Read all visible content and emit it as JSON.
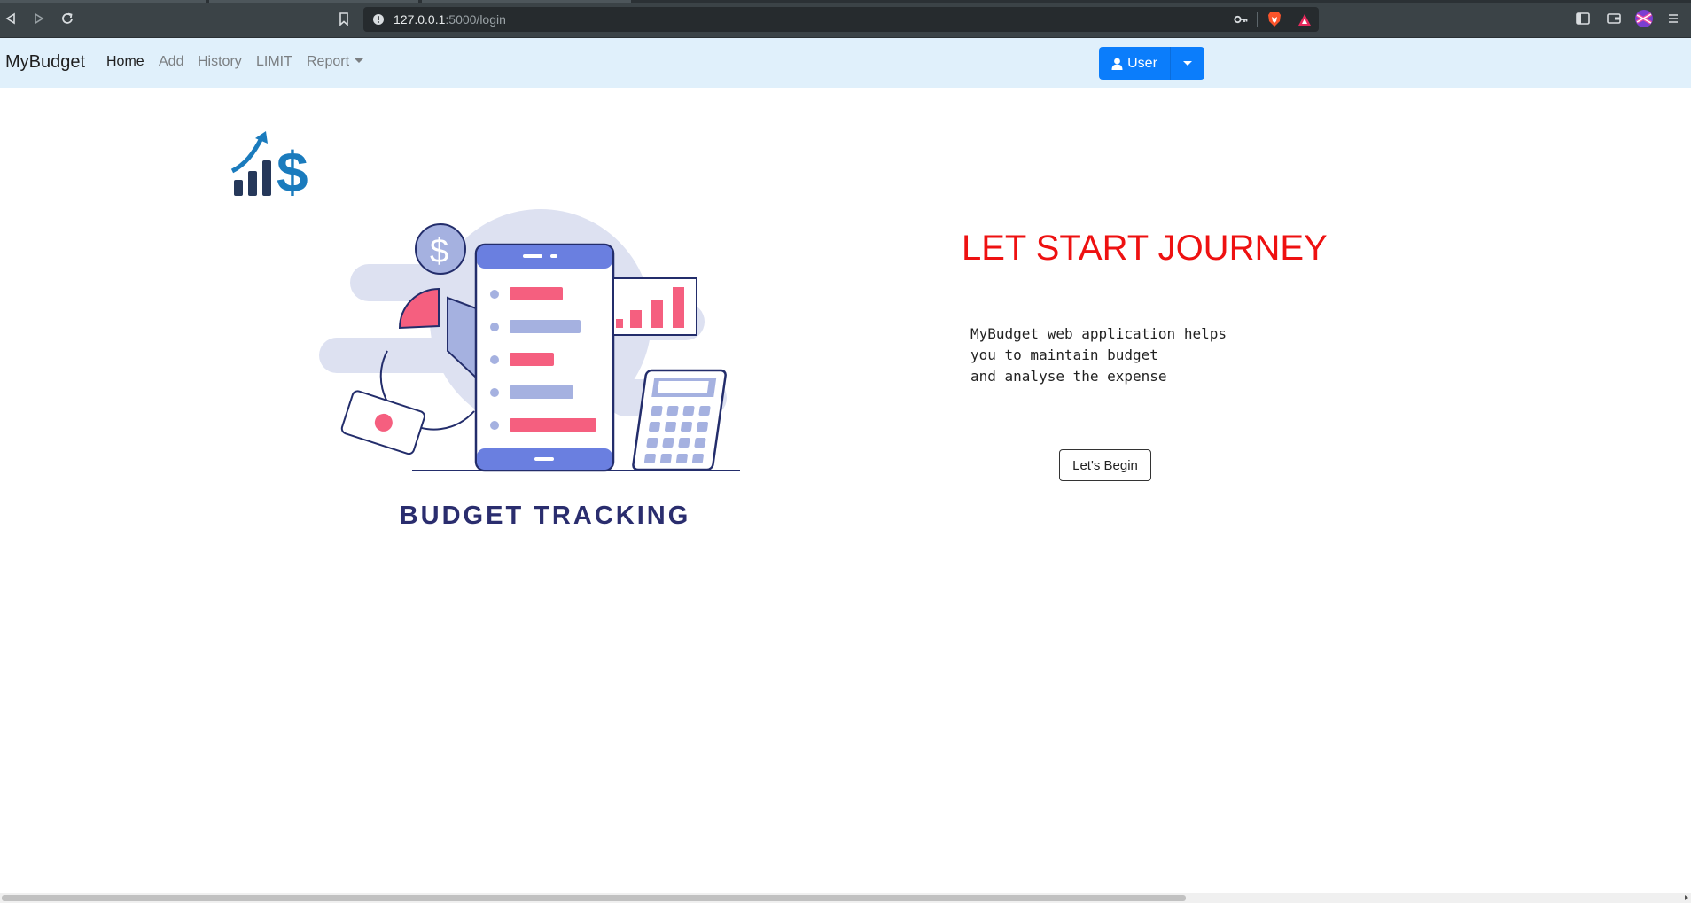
{
  "browser": {
    "url_host": "127.0.0.1",
    "url_path": ":5000/login"
  },
  "navbar": {
    "brand": "MyBudget",
    "links": [
      {
        "label": "Home"
      },
      {
        "label": "Add"
      },
      {
        "label": "History"
      },
      {
        "label": "LIMIT"
      },
      {
        "label": "Report"
      }
    ],
    "user_button": "User"
  },
  "hero": {
    "illustration_caption": "BUDGET TRACKING",
    "headline": "LET START JOURNEY",
    "description_lines": [
      "MyBudget web application helps",
      "you to maintain budget",
      "and analyse the expense"
    ],
    "begin_button": "Let's Begin"
  },
  "colors": {
    "navbar_bg": "#e0f0fb",
    "user_button": "#0b7dfb",
    "headline": "#ee1111"
  },
  "icons": [
    "back-icon",
    "forward-icon",
    "reload-icon",
    "bookmark-icon",
    "site-info-icon",
    "key-icon",
    "brave-shield-icon",
    "brave-rewards-icon",
    "sidebar-icon",
    "wallet-icon",
    "profile-icon",
    "menu-icon",
    "user-icon",
    "chevron-down-icon"
  ]
}
